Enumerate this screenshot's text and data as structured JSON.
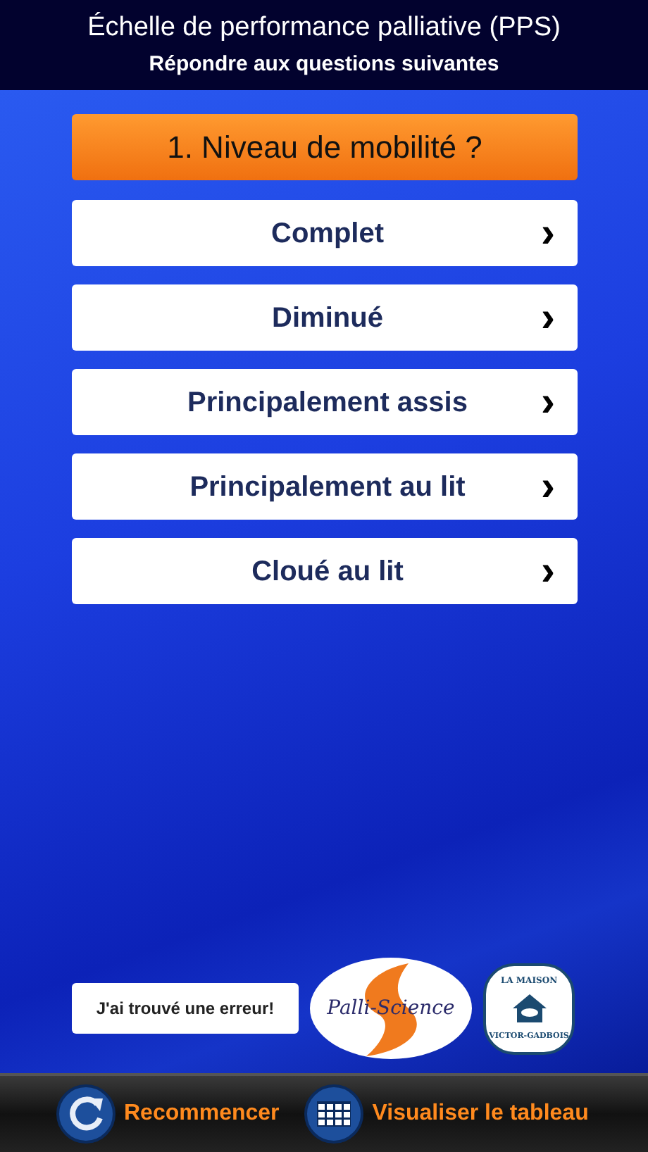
{
  "header": {
    "title": "Échelle de performance palliative (PPS)",
    "subtitle": "Répondre aux questions suivantes"
  },
  "question": "1. Niveau de mobilité ?",
  "options": [
    {
      "label": "Complet",
      "arrow": "›"
    },
    {
      "label": "Diminué",
      "arrow": "›"
    },
    {
      "label": "Principalement assis",
      "arrow": "›"
    },
    {
      "label": "Principalement au lit",
      "arrow": "›"
    },
    {
      "label": "Cloué au lit",
      "arrow": "›"
    }
  ],
  "report_button": "J'ai trouvé une erreur!",
  "logos": {
    "palli": "Palli-Science",
    "maison_top": "LA MAISON",
    "maison_bottom": "VICTOR-GADBOIS"
  },
  "toolbar": [
    {
      "kind": "restart",
      "label": "Recommencer"
    },
    {
      "kind": "table",
      "label": "Visualiser le tableau"
    }
  ]
}
